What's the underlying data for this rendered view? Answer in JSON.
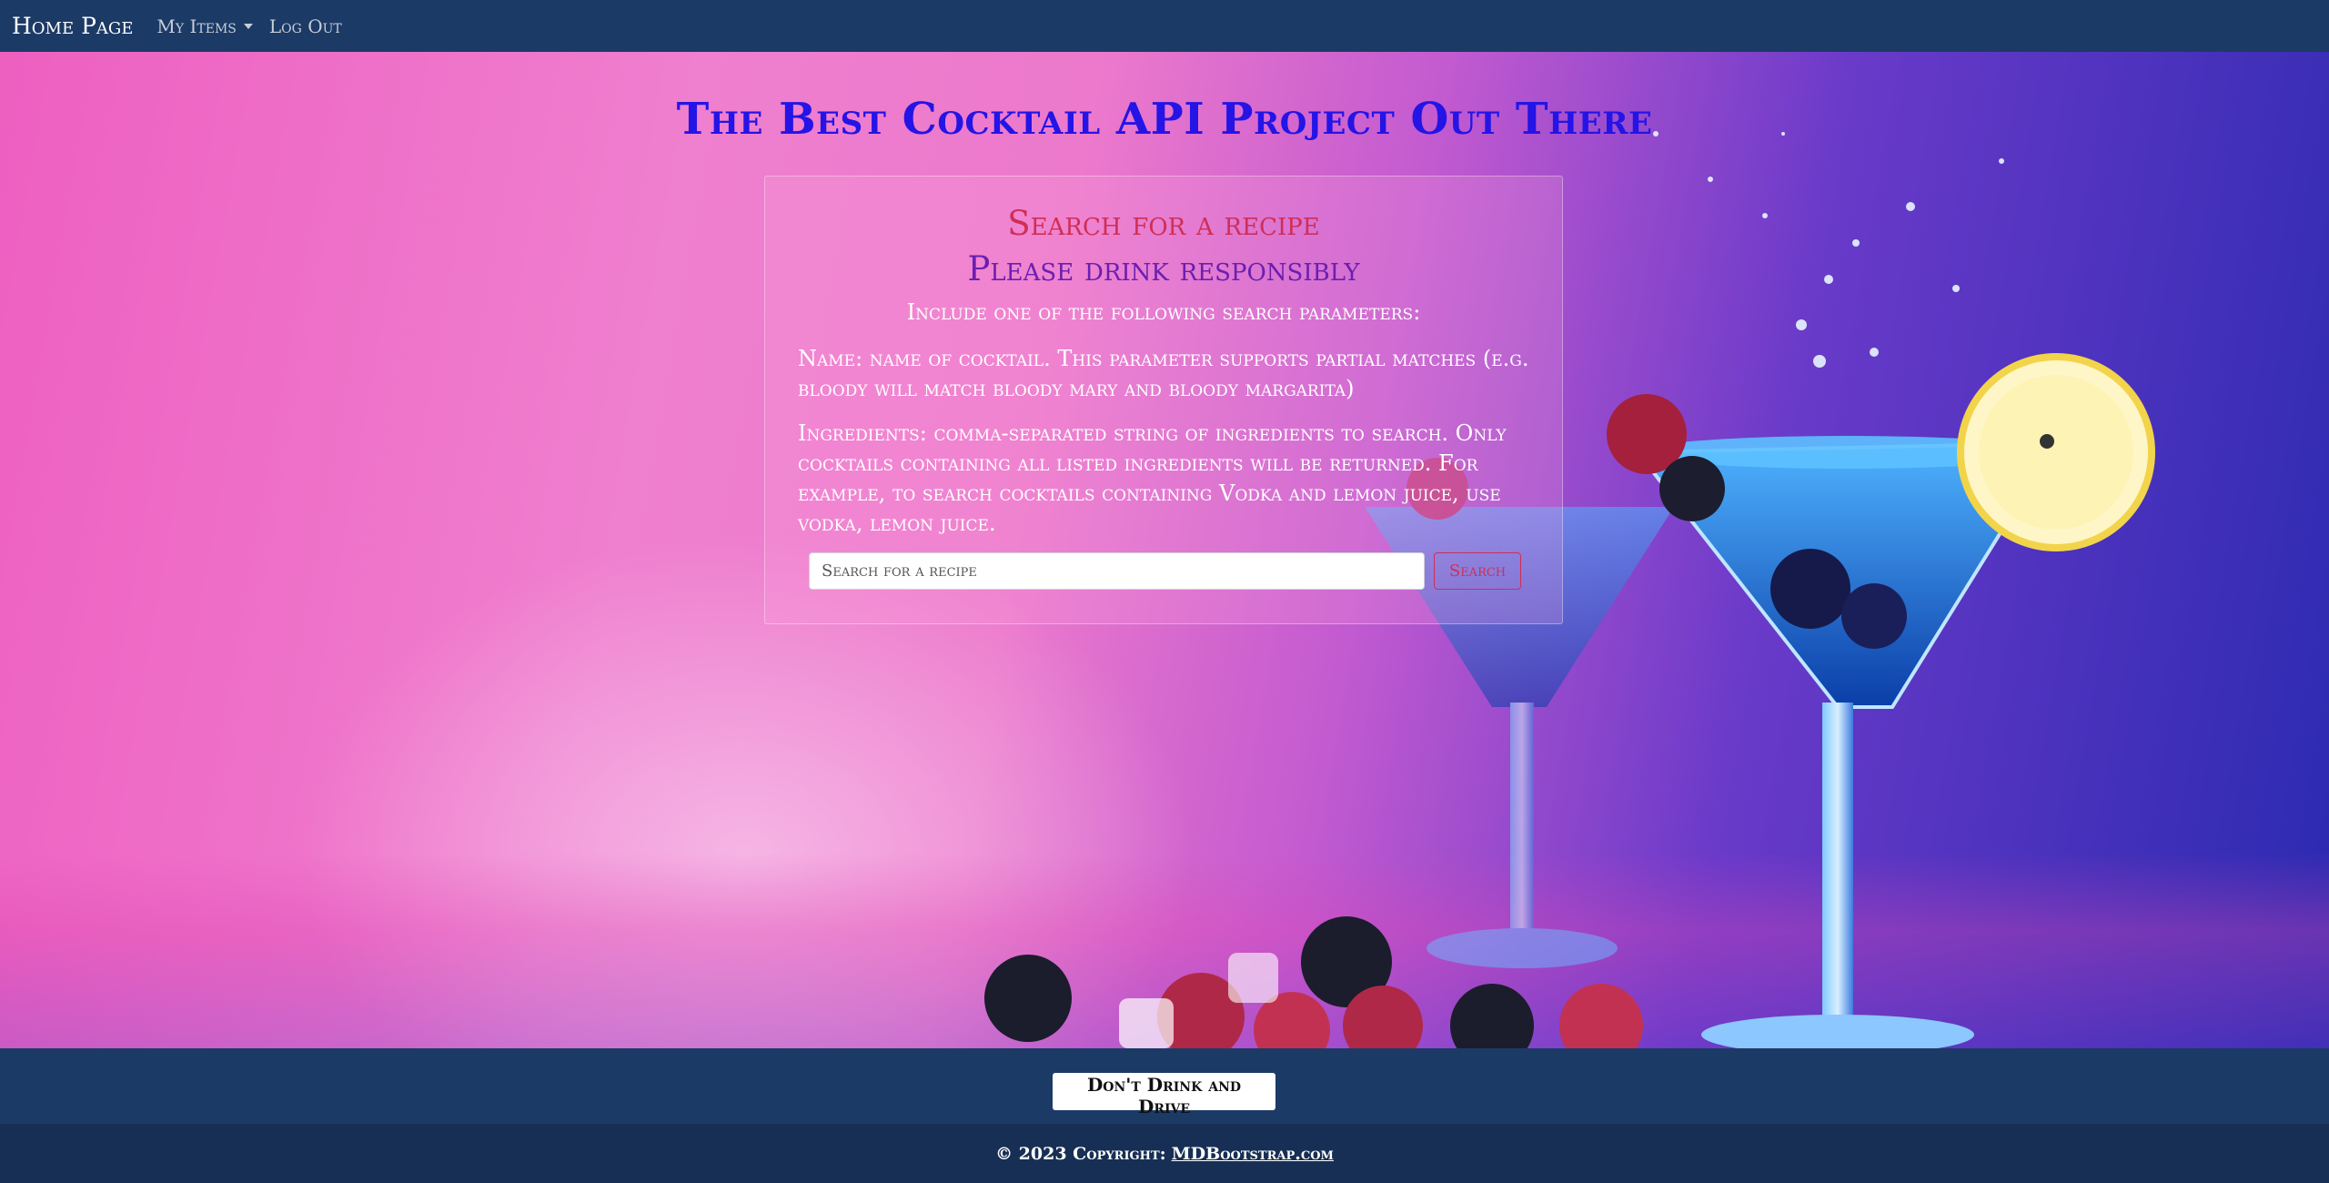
{
  "navbar": {
    "brand": "Home Page",
    "my_items": "My Items",
    "logout": "Log Out"
  },
  "hero": {
    "title": "The Best Cocktail API Project Out There"
  },
  "card": {
    "heading": "Search for a recipe",
    "subheading": "Please drink responsibly",
    "intro": "Include one of the following search parameters:",
    "name_param": "Name: name of cocktail. This parameter supports partial matches (e.g. bloody will match bloody mary and bloody margarita)",
    "ingredients_param": "Ingredients: comma-separated string of ingredients to search. Only cocktails containing all listed ingredients will be returned. For example, to search cocktails containing Vodka and lemon juice, use vodka, lemon juice.",
    "search_placeholder": "Search for a recipe",
    "search_value": "",
    "search_button": "Search"
  },
  "footer": {
    "button": "Don't Drink and Drive",
    "copyright_prefix": "© 2023 Copyright:",
    "copyright_link": "MDBootstrap.com"
  },
  "colors": {
    "navbar": "#1b3a66",
    "title": "#2414e6",
    "search_heading": "#cf2f55",
    "drink_heading": "#6a1fb0"
  }
}
